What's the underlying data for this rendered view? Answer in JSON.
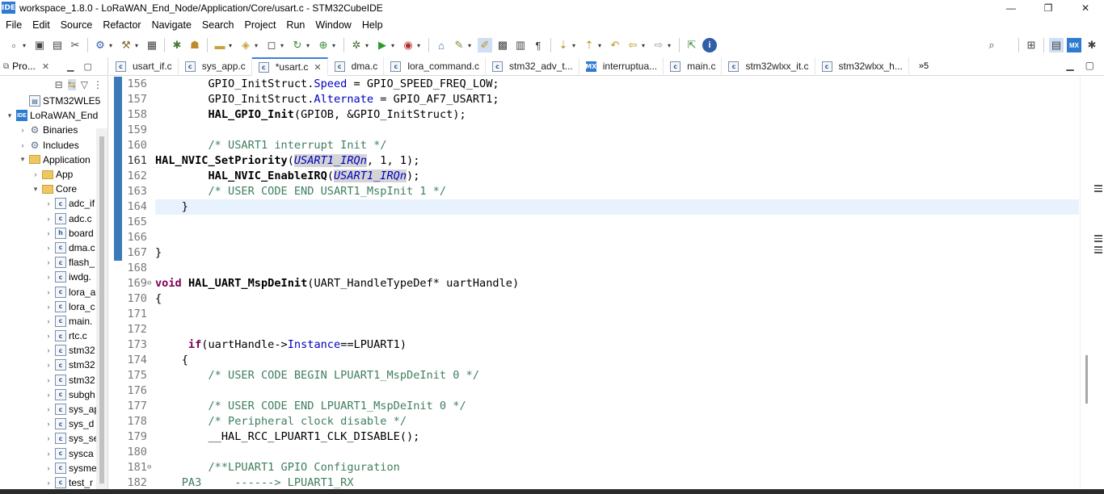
{
  "window": {
    "title": "workspace_1.8.0 - LoRaWAN_End_Node/Application/Core/usart.c - STM32CubeIDE",
    "icon_text": "IDE",
    "controls": [
      "—",
      "❐",
      "✕"
    ]
  },
  "menu": [
    "File",
    "Edit",
    "Source",
    "Refactor",
    "Navigate",
    "Search",
    "Project",
    "Run",
    "Window",
    "Help"
  ],
  "left_panel": {
    "tab_label": "Pro...",
    "tree": [
      {
        "label": "STM32WLE5",
        "indent": 1,
        "icon": "chip",
        "twisty": ""
      },
      {
        "label": "LoRaWAN_End",
        "indent": 0,
        "icon": "project",
        "twisty": "▾"
      },
      {
        "label": "Binaries",
        "indent": 1,
        "icon": "bin",
        "twisty": "›"
      },
      {
        "label": "Includes",
        "indent": 1,
        "icon": "bin",
        "twisty": "›"
      },
      {
        "label": "Application",
        "indent": 1,
        "icon": "folder",
        "twisty": "▾"
      },
      {
        "label": "App",
        "indent": 2,
        "icon": "folder",
        "twisty": "›"
      },
      {
        "label": "Core",
        "indent": 2,
        "icon": "folder",
        "twisty": "▾"
      },
      {
        "label": "adc_if",
        "indent": 3,
        "icon": "c",
        "twisty": "›"
      },
      {
        "label": "adc.c",
        "indent": 3,
        "icon": "c",
        "twisty": "›"
      },
      {
        "label": "board",
        "indent": 3,
        "icon": "h",
        "twisty": "›"
      },
      {
        "label": "dma.c",
        "indent": 3,
        "icon": "c",
        "twisty": "›"
      },
      {
        "label": "flash_",
        "indent": 3,
        "icon": "c",
        "twisty": "›"
      },
      {
        "label": "iwdg.",
        "indent": 3,
        "icon": "c",
        "twisty": "›"
      },
      {
        "label": "lora_a",
        "indent": 3,
        "icon": "c",
        "twisty": "›"
      },
      {
        "label": "lora_c",
        "indent": 3,
        "icon": "c",
        "twisty": "›"
      },
      {
        "label": "main.",
        "indent": 3,
        "icon": "c",
        "twisty": "›"
      },
      {
        "label": "rtc.c",
        "indent": 3,
        "icon": "c",
        "twisty": "›"
      },
      {
        "label": "stm32",
        "indent": 3,
        "icon": "c",
        "twisty": "›"
      },
      {
        "label": "stm32",
        "indent": 3,
        "icon": "c",
        "twisty": "›"
      },
      {
        "label": "stm32",
        "indent": 3,
        "icon": "c",
        "twisty": "›"
      },
      {
        "label": "subgh",
        "indent": 3,
        "icon": "c",
        "twisty": "›"
      },
      {
        "label": "sys_ap",
        "indent": 3,
        "icon": "c",
        "twisty": "›"
      },
      {
        "label": "sys_d",
        "indent": 3,
        "icon": "c",
        "twisty": "›"
      },
      {
        "label": "sys_se",
        "indent": 3,
        "icon": "c",
        "twisty": "›"
      },
      {
        "label": "sysca",
        "indent": 3,
        "icon": "c",
        "twisty": "›"
      },
      {
        "label": "sysme",
        "indent": 3,
        "icon": "c",
        "twisty": "›"
      },
      {
        "label": "test_r",
        "indent": 3,
        "icon": "c",
        "twisty": "›"
      }
    ]
  },
  "editor_tabs": [
    {
      "label": "usart_if.c",
      "icon": "c",
      "active": false,
      "close": false
    },
    {
      "label": "sys_app.c",
      "icon": "c",
      "active": false,
      "close": false
    },
    {
      "label": "*usart.c",
      "icon": "c",
      "active": true,
      "close": true
    },
    {
      "label": "dma.c",
      "icon": "c",
      "active": false,
      "close": false
    },
    {
      "label": "lora_command.c",
      "icon": "c",
      "active": false,
      "close": false
    },
    {
      "label": "stm32_adv_t...",
      "icon": "c",
      "active": false,
      "close": false
    },
    {
      "label": "interruptua...",
      "icon": "mx",
      "active": false,
      "close": false
    },
    {
      "label": "main.c",
      "icon": "c",
      "active": false,
      "close": false
    },
    {
      "label": "stm32wlxx_it.c",
      "icon": "c",
      "active": false,
      "close": false
    },
    {
      "label": "stm32wlxx_h...",
      "icon": "c",
      "active": false,
      "close": false
    }
  ],
  "editor_overflow": "»5",
  "code": [
    {
      "n": "156",
      "html": "        GPIO_InitStruct.<span class='mem'>Speed</span> = GPIO_SPEED_FREQ_LOW;"
    },
    {
      "n": "157",
      "html": "        GPIO_InitStruct.<span class='mem'>Alternate</span> = GPIO_AF7_USART1;"
    },
    {
      "n": "158",
      "html": "        <span class='fn'>HAL_GPIO_Init</span>(GPIOB, &amp;GPIO_InitStruct);"
    },
    {
      "n": "159",
      "html": ""
    },
    {
      "n": "160",
      "html": "        <span class='cm'>/* USART1 interrupt Init */</span>"
    },
    {
      "n": "161",
      "cur": true,
      "html": "<span class='fn'>HAL_NVIC_SetPriority</span>(<span class='mc hl'>USART1_IRQn</span>, 1, 1);"
    },
    {
      "n": "162",
      "html": "        <span class='fn'>HAL_NVIC_EnableIRQ</span>(<span class='mc hl'>USART1_IRQn</span>);"
    },
    {
      "n": "163",
      "html": "        <span class='cm'>/* USER CODE END USART1_MspInit 1 */</span>"
    },
    {
      "n": "164",
      "html": "    }"
    },
    {
      "n": "165",
      "html": ""
    },
    {
      "n": "166",
      "html": ""
    },
    {
      "n": "167",
      "html": "}"
    },
    {
      "n": "168",
      "html": ""
    },
    {
      "n": "169",
      "fold": true,
      "html": "<span class='kw'>void</span> <span class='fn'>HAL_UART_MspDeInit</span>(UART_HandleTypeDef* uartHandle)"
    },
    {
      "n": "170",
      "html": "{"
    },
    {
      "n": "171",
      "html": ""
    },
    {
      "n": "172",
      "html": ""
    },
    {
      "n": "173",
      "html": "     <span class='kw'>if</span>(uartHandle-&gt;<span class='mem'>Instance</span>==LPUART1)"
    },
    {
      "n": "174",
      "html": "    {"
    },
    {
      "n": "175",
      "html": "        <span class='cm'>/* USER CODE BEGIN LPUART1_MspDeInit 0 */</span>"
    },
    {
      "n": "176",
      "html": ""
    },
    {
      "n": "177",
      "html": "        <span class='cm'>/* USER CODE END LPUART1_MspDeInit 0 */</span>"
    },
    {
      "n": "178",
      "html": "        <span class='cm'>/* Peripheral clock disable */</span>"
    },
    {
      "n": "179",
      "html": "        __HAL_RCC_LPUART1_CLK_DISABLE();"
    },
    {
      "n": "180",
      "html": ""
    },
    {
      "n": "181",
      "fold": true,
      "html": "        <span class='cm'>/**LPUART1 GPIO Configuration</span>"
    },
    {
      "n": "182",
      "html": "<span class='cm'>    PA3     ------&gt; LPUART1_RX</span>"
    }
  ]
}
